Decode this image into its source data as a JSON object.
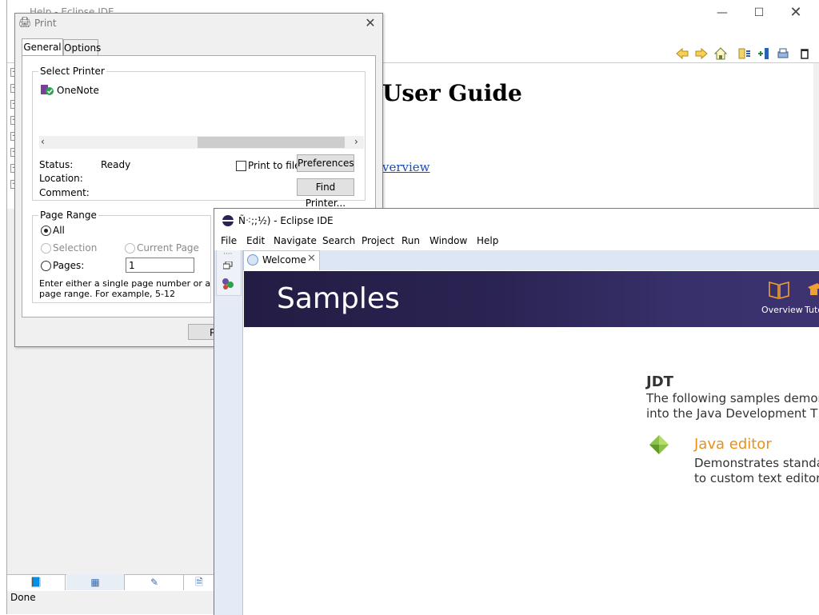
{
  "help_window": {
    "title": "Help - Eclipse IDE",
    "heading_partial": "User Guide",
    "link_partial": "verview",
    "status": "Done",
    "toolbar_icons": [
      "back-arrow-icon",
      "forward-arrow-icon",
      "home-icon",
      "sync-toc-icon",
      "show-in-toc-icon",
      "print-icon",
      "maximize-icon"
    ],
    "toc_items_count": 8,
    "bottom_tab_icons": [
      "contents-icon",
      "index-icon",
      "search-icon",
      "bookmarks-icon"
    ]
  },
  "print_dialog": {
    "title": "Print",
    "tabs": [
      "General",
      "Options"
    ],
    "select_printer_label": "Select Printer",
    "printers": [
      "OneNote"
    ],
    "status_label": "Status:",
    "status_value": "Ready",
    "location_label": "Location:",
    "comment_label": "Comment:",
    "print_to_file_label": "Print to file",
    "preferences_button": "Preferences",
    "find_printer_button": "Find Printer...",
    "page_range_label": "Page Range",
    "range_all": "All",
    "range_selection": "Selection",
    "range_current_page": "Current Page",
    "range_pages": "Pages:",
    "pages_value": "1",
    "hint_line1": "Enter either a single page number or a single",
    "hint_line2": "page range.  For example, 5-12",
    "print_button_partial": "P"
  },
  "eclipse_window": {
    "title": "Ñ⁖;;½) - Eclipse IDE",
    "menu": [
      "File",
      "Edit",
      "Navigate",
      "Search",
      "Project",
      "Run",
      "Window",
      "Help"
    ],
    "tab_label": "Welcome",
    "banner_title": "Samples",
    "banner_nav": [
      "Overview",
      "Tuto"
    ],
    "section_heading": "JDT",
    "section_line1": "The following samples demon",
    "section_line2": "into the Java Development T",
    "sample_title": "Java editor",
    "sample_line1": "Demonstrates standa",
    "sample_line2": "to custom text editor"
  },
  "colors": {
    "banner_dark": "#231c44",
    "sample_title": "#e8901a",
    "link": "#1a4bb5",
    "tab_bar": "#dce6f4"
  }
}
